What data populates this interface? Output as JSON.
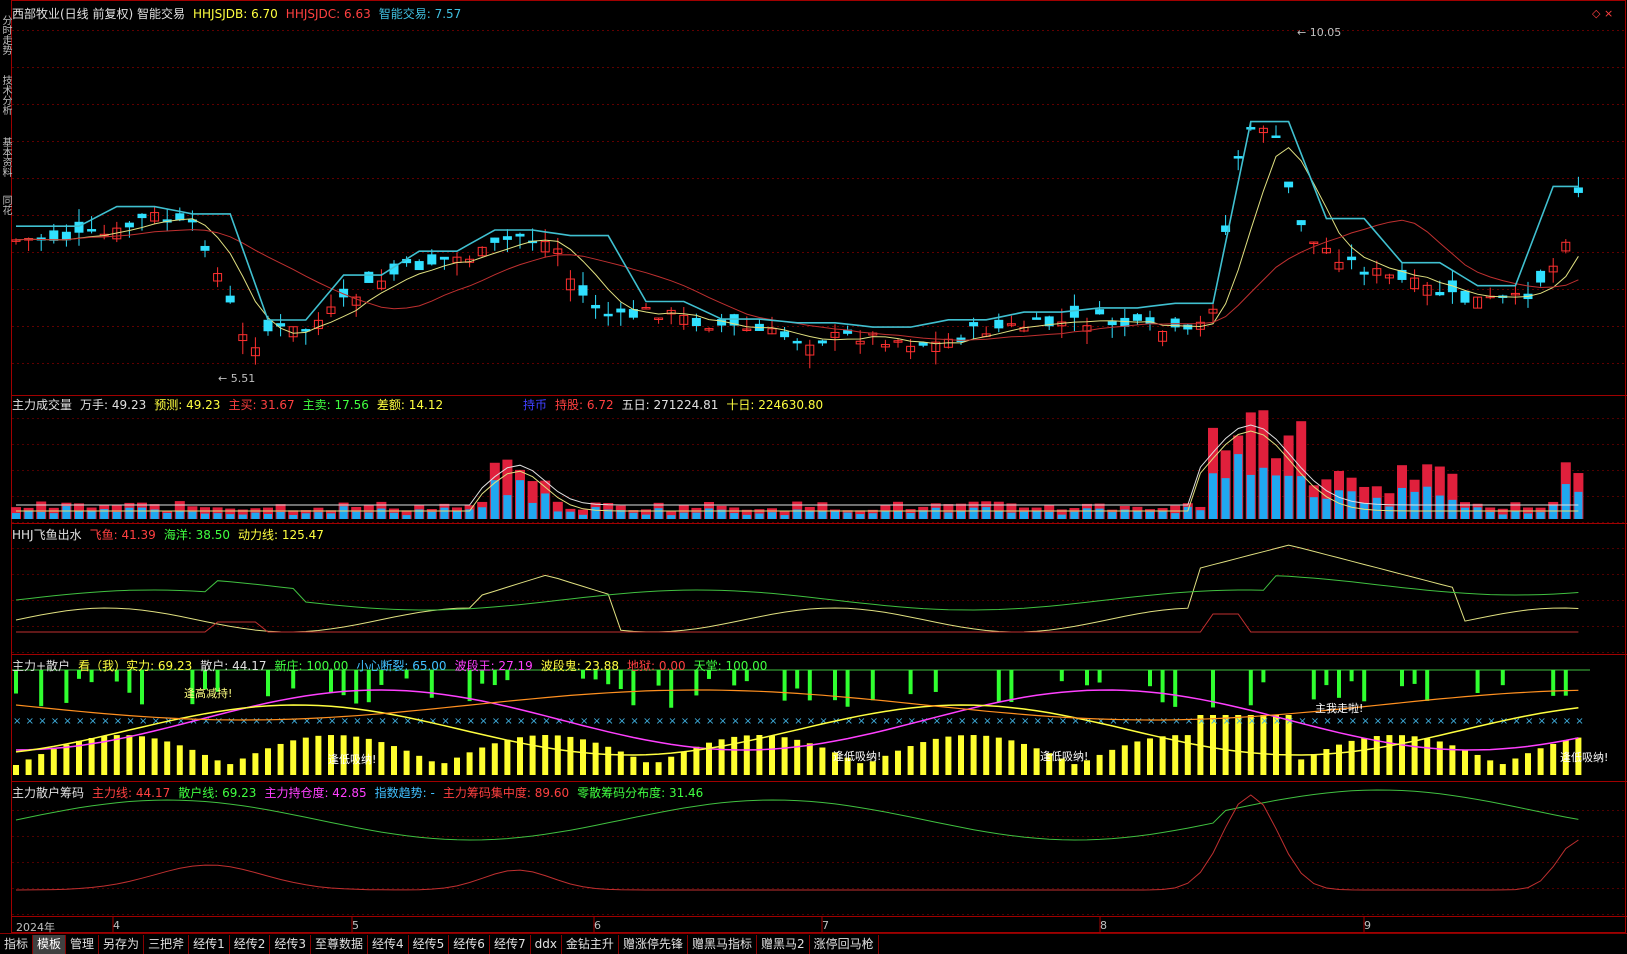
{
  "main_panel": {
    "legend": [
      {
        "text": "西部牧业(日线 前复权) 智能交易",
        "color": "#e0e0e0"
      },
      {
        "text": "HHJSJDB: 6.70",
        "color": "#ffff40"
      },
      {
        "text": "HHJSJDC: 6.63",
        "color": "#ff4040"
      },
      {
        "text": "智能交易: 7.57",
        "color": "#40c0e0"
      }
    ],
    "high_label": "10.05",
    "low_label": "5.51"
  },
  "volume_panel": {
    "legend": [
      {
        "text": "主力成交量",
        "color": "#e0e0e0"
      },
      {
        "text": "万手: 49.23",
        "color": "#e0e0e0"
      },
      {
        "text": "预测: 49.23",
        "color": "#ffff40"
      },
      {
        "text": "主买: 31.67",
        "color": "#ff4040"
      },
      {
        "text": "主卖: 17.56",
        "color": "#40ff40"
      },
      {
        "text": "差额: 14.12",
        "color": "#ffff40"
      }
    ],
    "legend2": [
      {
        "text": "持币",
        "color": "#4040ff"
      },
      {
        "text": "持股: 6.72",
        "color": "#ff4040"
      },
      {
        "text": "五日: 271224.81",
        "color": "#e0e0e0"
      },
      {
        "text": "十日: 224630.80",
        "color": "#ffff40"
      }
    ]
  },
  "fish_panel": {
    "legend": [
      {
        "text": "HHJ飞鱼出水",
        "color": "#e0e0e0"
      },
      {
        "text": "飞鱼: 41.39",
        "color": "#ff4040"
      },
      {
        "text": "海洋: 38.50",
        "color": "#40ff40"
      },
      {
        "text": "动力线: 125.47",
        "color": "#ffff40"
      }
    ]
  },
  "main_force_panel": {
    "legend": [
      {
        "text": "主力+散户",
        "color": "#e0e0e0"
      },
      {
        "text": "看（我）实力: 69.23",
        "color": "#ffff40"
      },
      {
        "text": "散户: 44.17",
        "color": "#e0e0e0"
      },
      {
        "text": "新庄: 100.00",
        "color": "#40ff40"
      },
      {
        "text": "小心断裂: 65.00",
        "color": "#40c0ff"
      },
      {
        "text": "波段王: 27.19",
        "color": "#ff40ff"
      },
      {
        "text": "波段鬼: 23.88",
        "color": "#ffff40"
      },
      {
        "text": "地狱: 0.00",
        "color": "#ff4040"
      },
      {
        "text": "天堂: 100.00",
        "color": "#40ff40"
      }
    ],
    "annotations": [
      "逢高减持!",
      "逢低吸纳!",
      "逢低吸纳!",
      "逢低吸纳!",
      "主我走啦!",
      "逢低吸纳!"
    ]
  },
  "chip_panel": {
    "legend": [
      {
        "text": "主力散户筹码",
        "color": "#e0e0e0"
      },
      {
        "text": "主力线: 44.17",
        "color": "#ff4040"
      },
      {
        "text": "散户线: 69.23",
        "color": "#40ff40"
      },
      {
        "text": "主力持仓度: 42.85",
        "color": "#ff40ff"
      },
      {
        "text": "指数趋势: -",
        "color": "#40c0ff"
      },
      {
        "text": "主力筹码集中度: 89.60",
        "color": "#ff4040"
      },
      {
        "text": "零散筹码分布度: 31.46",
        "color": "#40ff40"
      }
    ]
  },
  "side_tabs": [
    "分时走势",
    "技术分析",
    "基本资料",
    "同花"
  ],
  "date_axis": [
    "2024年",
    "4",
    "5",
    "6",
    "7",
    "8",
    "9"
  ],
  "bottom_tabs": [
    {
      "label": "指标",
      "active": false
    },
    {
      "label": "模板",
      "active": true
    },
    {
      "label": "管理",
      "active": false
    },
    {
      "label": "另存为",
      "active": false
    },
    {
      "label": "三把斧",
      "active": false
    },
    {
      "label": "经传1",
      "active": false
    },
    {
      "label": "经传2",
      "active": false
    },
    {
      "label": "经传3",
      "active": false
    },
    {
      "label": "至尊数据",
      "active": false
    },
    {
      "label": "经传4",
      "active": false
    },
    {
      "label": "经传5",
      "active": false
    },
    {
      "label": "经传6",
      "active": false
    },
    {
      "label": "经传7",
      "active": false
    },
    {
      "label": "ddx",
      "active": false
    },
    {
      "label": "金钻主升",
      "active": false
    },
    {
      "label": "赠涨停先锋",
      "active": false
    },
    {
      "label": "赠黑马指标",
      "active": false
    },
    {
      "label": "赠黑马2",
      "active": false
    },
    {
      "label": "涨停回马枪",
      "active": false
    }
  ],
  "colors": {
    "up": "#ff3030",
    "down": "#30e0ff",
    "ma_yellow": "#e0e080",
    "ma_red": "#c03030",
    "border": "#a00000"
  }
}
